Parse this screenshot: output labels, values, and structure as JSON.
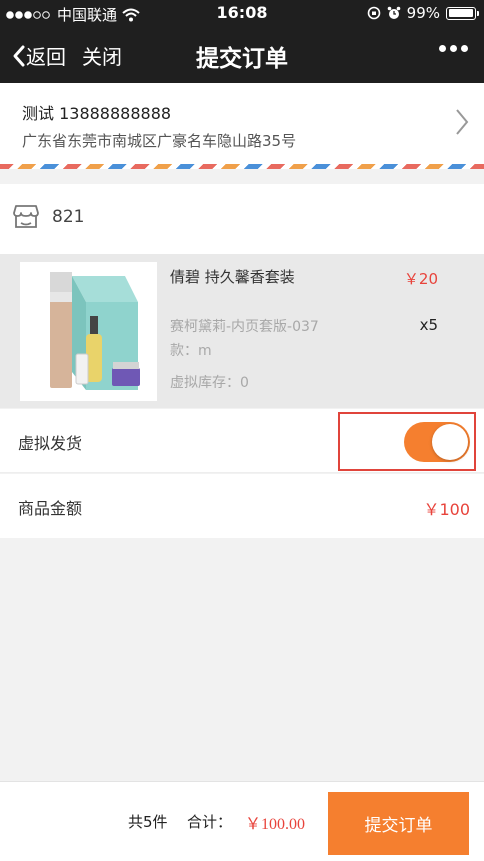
{
  "status_bar": {
    "carrier": "中国联通",
    "time": "16:08",
    "battery": "99%",
    "battery_level": 0.99
  },
  "nav": {
    "back_label": "返回",
    "close_label": "关闭",
    "title": "提交订单"
  },
  "address": {
    "name_phone": "测试 13888888888",
    "detail": "广东省东莞市南城区广豪名车隐山路35号"
  },
  "shop": {
    "name": "821"
  },
  "product": {
    "name": "倩碧 持久馨香套装",
    "price": "￥20",
    "spec": "赛柯黛莉-内页套版-037",
    "size": "款：m",
    "quantity": "x5",
    "stock": "虚拟库存：0"
  },
  "virtual_delivery": {
    "label": "虚拟发货",
    "enabled": true
  },
  "goods_amount": {
    "label": "商品金额",
    "value": "￥100"
  },
  "footer": {
    "count": "共5件",
    "total_label": "合计：",
    "total": "￥100.00",
    "submit_label": "提交订单"
  },
  "colors": {
    "accent": "#f57f2f",
    "price": "#e8433b",
    "highlight_border": "#e0443b",
    "nav_background": "#1f1f1f"
  }
}
